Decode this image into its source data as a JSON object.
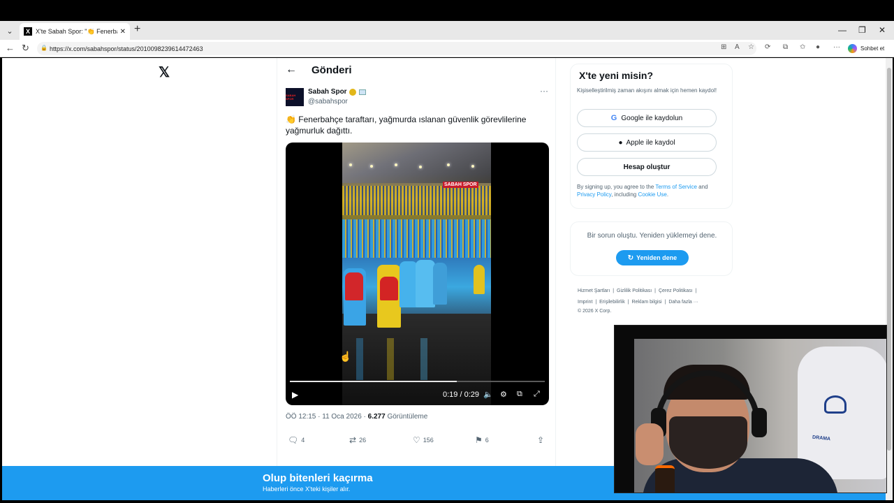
{
  "browser": {
    "tab_title": "X'te Sabah Spor: \"👏 Fenerbahçe",
    "tab_icon_letter": "X",
    "url": "https://x.com/sabahspor/status/2010098239614472463",
    "copilot_label": "Sohbet et"
  },
  "sidebar": {
    "logo": "𝕏"
  },
  "header": {
    "title": "Gönderi"
  },
  "tweet": {
    "author_name": "Sabah Spor",
    "handle": "@sabahspor",
    "avatar_text": "SABAH SPOR",
    "text": "👏 Fenerbahçe taraftarı, yağmurda ıslanan güvenlik görevlilerine yağmurluk dağıttı.",
    "video": {
      "watermark": "SABAH SPOR",
      "time": "0:19 / 0:29",
      "progress": 0.655
    },
    "time_date": "ÖÖ 12:15 · 11 Oca 2026 · ",
    "views_count": "6.277",
    "views_label": "Görüntüleme",
    "replies": "4",
    "reposts": "26",
    "likes": "156",
    "bookmarks": "6"
  },
  "signup": {
    "title": "X'te yeni misin?",
    "subtitle": "Kişiselleştirilmiş zaman akışını almak için hemen kaydol!",
    "google_label": "Google ile kaydolun",
    "apple_label": "Apple ile kaydol",
    "create_label": "Hesap oluştur",
    "legal_prefix": "By signing up, you agree to the ",
    "terms": "Terms of Service",
    "and": " and ",
    "privacy": "Privacy Policy",
    "including": ", including ",
    "cookie": "Cookie Use",
    "period": "."
  },
  "error": {
    "message": "Bir sorun oluştu. Yeniden yüklemeyi dene.",
    "retry_label": "Yeniden dene"
  },
  "footer": {
    "links": [
      "Hizmet Şartları",
      "|",
      "Gizlilik Politikası",
      "|",
      "Çerez Politikası",
      "|",
      "Imprint",
      "|",
      "Erişilebilirlik",
      "|",
      "Reklam bilgisi",
      "|",
      "Daha fazla ···"
    ],
    "copyright": "© 2026 X Corp."
  },
  "banner": {
    "title": "Olup bitenleri kaçırma",
    "subtitle": "Haberleri önce X'teki kişiler alır."
  },
  "webcam": {
    "chair_text": "DRAMA"
  },
  "colors": {
    "accent": "#1d9bf0",
    "text": "#0f1419",
    "muted": "#536471"
  }
}
